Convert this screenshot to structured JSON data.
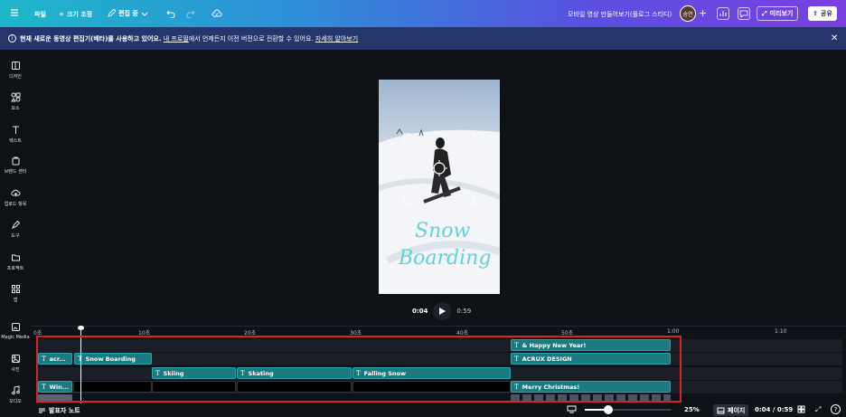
{
  "topbar": {
    "menu_icon": "hamburger-icon",
    "file": "파일",
    "resize": "크기 조정",
    "edit_mode": "편집 중",
    "title": "모바일 영상 만들어보기(플로그 스티디)",
    "avatar": "송연",
    "preview": "미리보기",
    "share": "공유"
  },
  "banner": {
    "text_a": "현재 새로운 동영상 편집기(베타)를 사용하고 있어요.",
    "link_profile": "내 프로필",
    "text_b": "에서 언제든지 이전 버전으로 전환할 수 있어요.",
    "link_more": "자세히 알아보기"
  },
  "sidebar": [
    {
      "label": "디자인",
      "icon": "layout-icon"
    },
    {
      "label": "요소",
      "icon": "elements-icon"
    },
    {
      "label": "텍스트",
      "icon": "text-icon"
    },
    {
      "label": "브랜드 센터",
      "icon": "brand-icon"
    },
    {
      "label": "업로드 항목",
      "icon": "upload-cloud-icon"
    },
    {
      "label": "도구",
      "icon": "draw-tool-icon"
    },
    {
      "label": "프로젝트",
      "icon": "folder-icon"
    },
    {
      "label": "앱",
      "icon": "apps-icon"
    },
    {
      "label": "Magic Media",
      "icon": "magic-media-icon"
    },
    {
      "label": "사진",
      "icon": "photo-icon"
    },
    {
      "label": "오디오",
      "icon": "audio-icon"
    }
  ],
  "video": {
    "title_line1": "Snow",
    "title_line2": "Boarding"
  },
  "player": {
    "current": "0:04",
    "total": "0:59"
  },
  "ruler": [
    "0초",
    "10초",
    "20초",
    "30초",
    "40초",
    "50초",
    "1:00",
    "1:10"
  ],
  "clips": {
    "r1_happy": "& Happy New Year!",
    "r2_acr": "acr...",
    "r2_snow": "Snow Boarding",
    "r2_acrux": "ACRUX DESIGN",
    "r3_skiing": "Skiing",
    "r3_skating": "Skating",
    "r3_falling": "Falling Snow",
    "r4_win": "Win...",
    "r4_merry": "Merry Christmas!"
  },
  "bottombar": {
    "notes": "발표자 노트",
    "zoom": "25%",
    "pages": "페이지",
    "time": "0:04 / 0:59"
  },
  "colors": {
    "clip": "#1a7a80",
    "highlight": "#d9232a",
    "banner": "#25366c"
  }
}
